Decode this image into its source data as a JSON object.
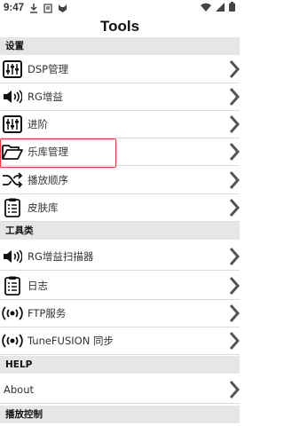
{
  "status": {
    "time": "9:47"
  },
  "header": {
    "title": "Tools"
  },
  "sections": {
    "settings": "设置",
    "tools": "工具类",
    "help": "HELP",
    "playback": "播放控制"
  },
  "rows": {
    "dsp": "DSP管理",
    "rg_gain": "RG增益",
    "advanced": "进阶",
    "library": "乐库管理",
    "play_order": "播放顺序",
    "skins": "皮肤库",
    "rg_scanner": "RG增益扫描器",
    "log": "日志",
    "ftp": "FTP服务",
    "tunefusion": "TuneFUSION 同步",
    "about": "About"
  },
  "colors": {
    "highlight": "#e53935",
    "section_bg": "#e6e6e6",
    "chevron": "#555555"
  }
}
